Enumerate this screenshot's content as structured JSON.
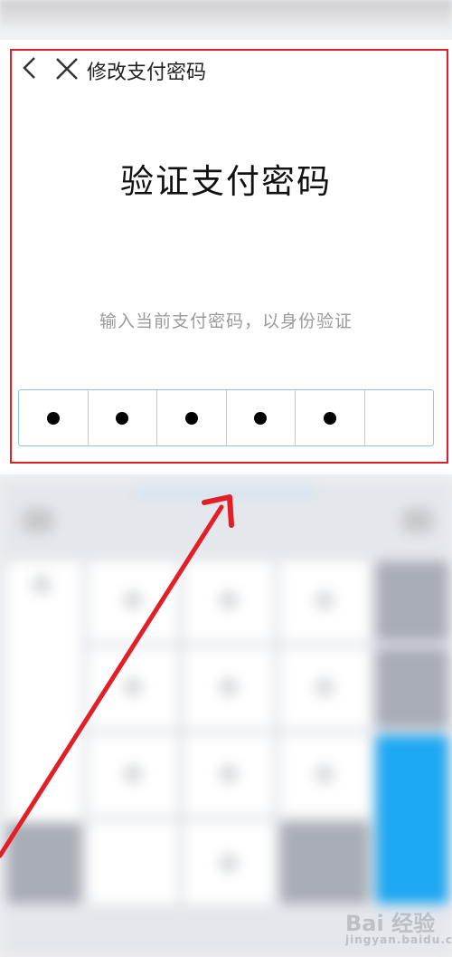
{
  "nav": {
    "back_icon": "chevron-left-icon",
    "close_icon": "close-icon",
    "title": "修改支付密码"
  },
  "main": {
    "title": "验证支付密码",
    "subtitle": "输入当前支付密码，以身份验证"
  },
  "pin": {
    "length": 6,
    "filled": 5,
    "cells": [
      "●",
      "●",
      "●",
      "●",
      "●",
      ""
    ]
  },
  "annotation": {
    "box_color": "#e21f26",
    "arrow_color": "#e21f26"
  },
  "watermark": {
    "text": "Bai 经验",
    "subtext": "jingyan.baidu.com"
  },
  "colors": {
    "accent_blue": "#1ea7f2",
    "pin_border": "#8fc3ee"
  }
}
